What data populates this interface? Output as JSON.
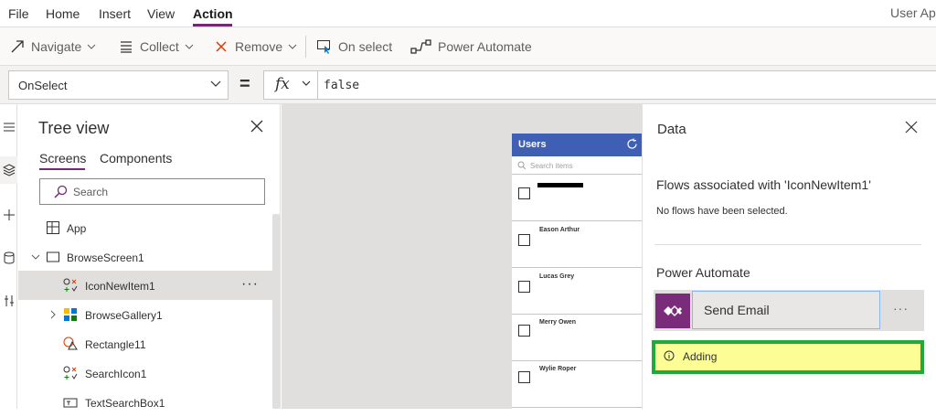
{
  "menubar": {
    "items": [
      "File",
      "Home",
      "Insert",
      "View",
      "Action"
    ],
    "active": "Action",
    "app_title": "User Ap"
  },
  "ribbon": {
    "navigate": "Navigate",
    "collect": "Collect",
    "remove": "Remove",
    "on_select": "On select",
    "power_automate": "Power Automate"
  },
  "formula": {
    "property": "OnSelect",
    "equals": "=",
    "fx": "fx",
    "value": "false"
  },
  "tree": {
    "title": "Tree view",
    "tabs": [
      "Screens",
      "Components"
    ],
    "active_tab": "Screens",
    "search_placeholder": "Search",
    "rows": [
      {
        "label": "App"
      },
      {
        "label": "BrowseScreen1"
      },
      {
        "label": "IconNewItem1",
        "more": "···"
      },
      {
        "label": "BrowseGallery1"
      },
      {
        "label": "Rectangle11"
      },
      {
        "label": "SearchIcon1"
      },
      {
        "label": "TextSearchBox1"
      }
    ]
  },
  "phone": {
    "header": "Users",
    "search_placeholder": "Search items",
    "rows": [
      "",
      "Eason Arthur",
      "Lucas Grey",
      "Merry Owen",
      "Wylie Roper"
    ]
  },
  "data_pane": {
    "title": "Data",
    "flows_header": "Flows associated with 'IconNewItem1'",
    "no_flows": "No flows have been selected.",
    "power_automate_header": "Power Automate",
    "flow_name": "Send Email",
    "flow_more": "···",
    "status": "Adding"
  },
  "colors": {
    "accent": "#742774",
    "phone_header": "#3f5fb4",
    "highlight_border": "#1faa3a",
    "highlight_fill": "#fdfd96"
  }
}
